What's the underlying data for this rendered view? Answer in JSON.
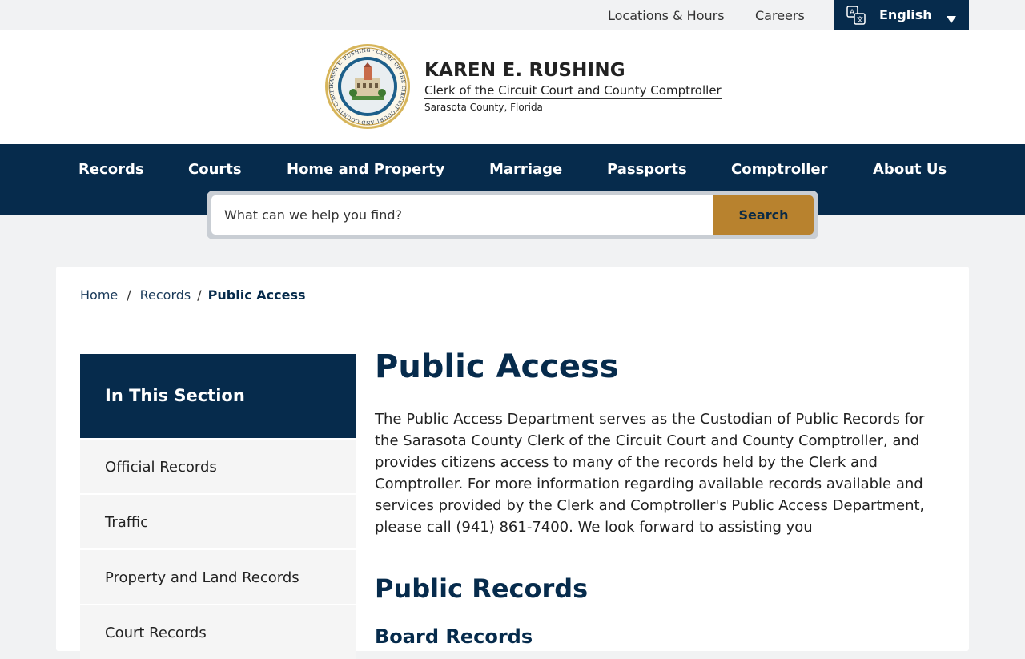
{
  "utility": {
    "locations_label": "Locations & Hours",
    "careers_label": "Careers",
    "language_label": "English"
  },
  "brand": {
    "name": "KAREN E. RUSHING",
    "title": "Clerk of the Circuit Court and County Comptroller",
    "subtitle": "Sarasota County, Florida",
    "seal_text": "KAREN E. RUSHING · CLERK OF THE CIRCUIT COURT AND COUNTY COMPTROLLER"
  },
  "nav": {
    "items": [
      "Records",
      "Courts",
      "Home and Property",
      "Marriage",
      "Passports",
      "Comptroller",
      "About Us"
    ]
  },
  "search": {
    "placeholder": "What can we help you find?",
    "button_label": "Search"
  },
  "breadcrumb": {
    "home": "Home",
    "records": "Records",
    "separator": "/",
    "current": "Public Access"
  },
  "sidebar": {
    "header": "In This Section",
    "items": [
      "Official Records",
      "Traffic",
      "Property and Land Records",
      "Court Records"
    ]
  },
  "article": {
    "title": "Public Access",
    "intro": "The Public Access Department serves as the Custodian of Public Records for the Sarasota County Clerk of the Circuit Court and County Comptroller, and provides citizens access to many of the records held by the Clerk and Comptroller. For more information regarding available records available and services provided by the Clerk and Comptroller's Public Access Department, please call (941) 861-7400. We look forward to assisting you",
    "section_title": "Public Records",
    "subsection_title": "Board Records"
  },
  "colors": {
    "navy": "#062b4c",
    "gold": "#b8822e",
    "page_bg": "#f1f2f3"
  }
}
